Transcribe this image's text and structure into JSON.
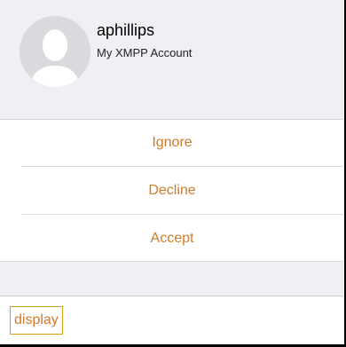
{
  "profile": {
    "username": "aphillips",
    "account_label": "My XMPP Account"
  },
  "actions": {
    "ignore_label": "Ignore",
    "decline_label": "Decline",
    "accept_label": "Accept"
  },
  "bottom": {
    "display_label": "display"
  },
  "colors": {
    "accent": "#d07a2a",
    "background": "#efeff4",
    "display_border": "#d4a017"
  },
  "icons": {
    "avatar": "person-silhouette-icon"
  }
}
